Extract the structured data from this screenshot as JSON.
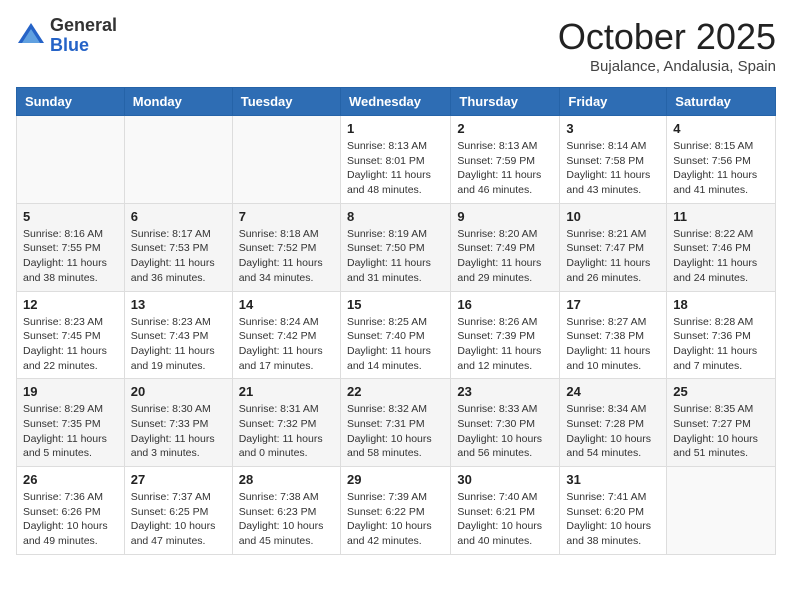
{
  "header": {
    "logo_general": "General",
    "logo_blue": "Blue",
    "month_title": "October 2025",
    "location": "Bujalance, Andalusia, Spain"
  },
  "weekdays": [
    "Sunday",
    "Monday",
    "Tuesday",
    "Wednesday",
    "Thursday",
    "Friday",
    "Saturday"
  ],
  "weeks": [
    [
      {
        "day": "",
        "info": ""
      },
      {
        "day": "",
        "info": ""
      },
      {
        "day": "",
        "info": ""
      },
      {
        "day": "1",
        "info": "Sunrise: 8:13 AM\nSunset: 8:01 PM\nDaylight: 11 hours\nand 48 minutes."
      },
      {
        "day": "2",
        "info": "Sunrise: 8:13 AM\nSunset: 7:59 PM\nDaylight: 11 hours\nand 46 minutes."
      },
      {
        "day": "3",
        "info": "Sunrise: 8:14 AM\nSunset: 7:58 PM\nDaylight: 11 hours\nand 43 minutes."
      },
      {
        "day": "4",
        "info": "Sunrise: 8:15 AM\nSunset: 7:56 PM\nDaylight: 11 hours\nand 41 minutes."
      }
    ],
    [
      {
        "day": "5",
        "info": "Sunrise: 8:16 AM\nSunset: 7:55 PM\nDaylight: 11 hours\nand 38 minutes."
      },
      {
        "day": "6",
        "info": "Sunrise: 8:17 AM\nSunset: 7:53 PM\nDaylight: 11 hours\nand 36 minutes."
      },
      {
        "day": "7",
        "info": "Sunrise: 8:18 AM\nSunset: 7:52 PM\nDaylight: 11 hours\nand 34 minutes."
      },
      {
        "day": "8",
        "info": "Sunrise: 8:19 AM\nSunset: 7:50 PM\nDaylight: 11 hours\nand 31 minutes."
      },
      {
        "day": "9",
        "info": "Sunrise: 8:20 AM\nSunset: 7:49 PM\nDaylight: 11 hours\nand 29 minutes."
      },
      {
        "day": "10",
        "info": "Sunrise: 8:21 AM\nSunset: 7:47 PM\nDaylight: 11 hours\nand 26 minutes."
      },
      {
        "day": "11",
        "info": "Sunrise: 8:22 AM\nSunset: 7:46 PM\nDaylight: 11 hours\nand 24 minutes."
      }
    ],
    [
      {
        "day": "12",
        "info": "Sunrise: 8:23 AM\nSunset: 7:45 PM\nDaylight: 11 hours\nand 22 minutes."
      },
      {
        "day": "13",
        "info": "Sunrise: 8:23 AM\nSunset: 7:43 PM\nDaylight: 11 hours\nand 19 minutes."
      },
      {
        "day": "14",
        "info": "Sunrise: 8:24 AM\nSunset: 7:42 PM\nDaylight: 11 hours\nand 17 minutes."
      },
      {
        "day": "15",
        "info": "Sunrise: 8:25 AM\nSunset: 7:40 PM\nDaylight: 11 hours\nand 14 minutes."
      },
      {
        "day": "16",
        "info": "Sunrise: 8:26 AM\nSunset: 7:39 PM\nDaylight: 11 hours\nand 12 minutes."
      },
      {
        "day": "17",
        "info": "Sunrise: 8:27 AM\nSunset: 7:38 PM\nDaylight: 11 hours\nand 10 minutes."
      },
      {
        "day": "18",
        "info": "Sunrise: 8:28 AM\nSunset: 7:36 PM\nDaylight: 11 hours\nand 7 minutes."
      }
    ],
    [
      {
        "day": "19",
        "info": "Sunrise: 8:29 AM\nSunset: 7:35 PM\nDaylight: 11 hours\nand 5 minutes."
      },
      {
        "day": "20",
        "info": "Sunrise: 8:30 AM\nSunset: 7:33 PM\nDaylight: 11 hours\nand 3 minutes."
      },
      {
        "day": "21",
        "info": "Sunrise: 8:31 AM\nSunset: 7:32 PM\nDaylight: 11 hours\nand 0 minutes."
      },
      {
        "day": "22",
        "info": "Sunrise: 8:32 AM\nSunset: 7:31 PM\nDaylight: 10 hours\nand 58 minutes."
      },
      {
        "day": "23",
        "info": "Sunrise: 8:33 AM\nSunset: 7:30 PM\nDaylight: 10 hours\nand 56 minutes."
      },
      {
        "day": "24",
        "info": "Sunrise: 8:34 AM\nSunset: 7:28 PM\nDaylight: 10 hours\nand 54 minutes."
      },
      {
        "day": "25",
        "info": "Sunrise: 8:35 AM\nSunset: 7:27 PM\nDaylight: 10 hours\nand 51 minutes."
      }
    ],
    [
      {
        "day": "26",
        "info": "Sunrise: 7:36 AM\nSunset: 6:26 PM\nDaylight: 10 hours\nand 49 minutes."
      },
      {
        "day": "27",
        "info": "Sunrise: 7:37 AM\nSunset: 6:25 PM\nDaylight: 10 hours\nand 47 minutes."
      },
      {
        "day": "28",
        "info": "Sunrise: 7:38 AM\nSunset: 6:23 PM\nDaylight: 10 hours\nand 45 minutes."
      },
      {
        "day": "29",
        "info": "Sunrise: 7:39 AM\nSunset: 6:22 PM\nDaylight: 10 hours\nand 42 minutes."
      },
      {
        "day": "30",
        "info": "Sunrise: 7:40 AM\nSunset: 6:21 PM\nDaylight: 10 hours\nand 40 minutes."
      },
      {
        "day": "31",
        "info": "Sunrise: 7:41 AM\nSunset: 6:20 PM\nDaylight: 10 hours\nand 38 minutes."
      },
      {
        "day": "",
        "info": ""
      }
    ]
  ]
}
